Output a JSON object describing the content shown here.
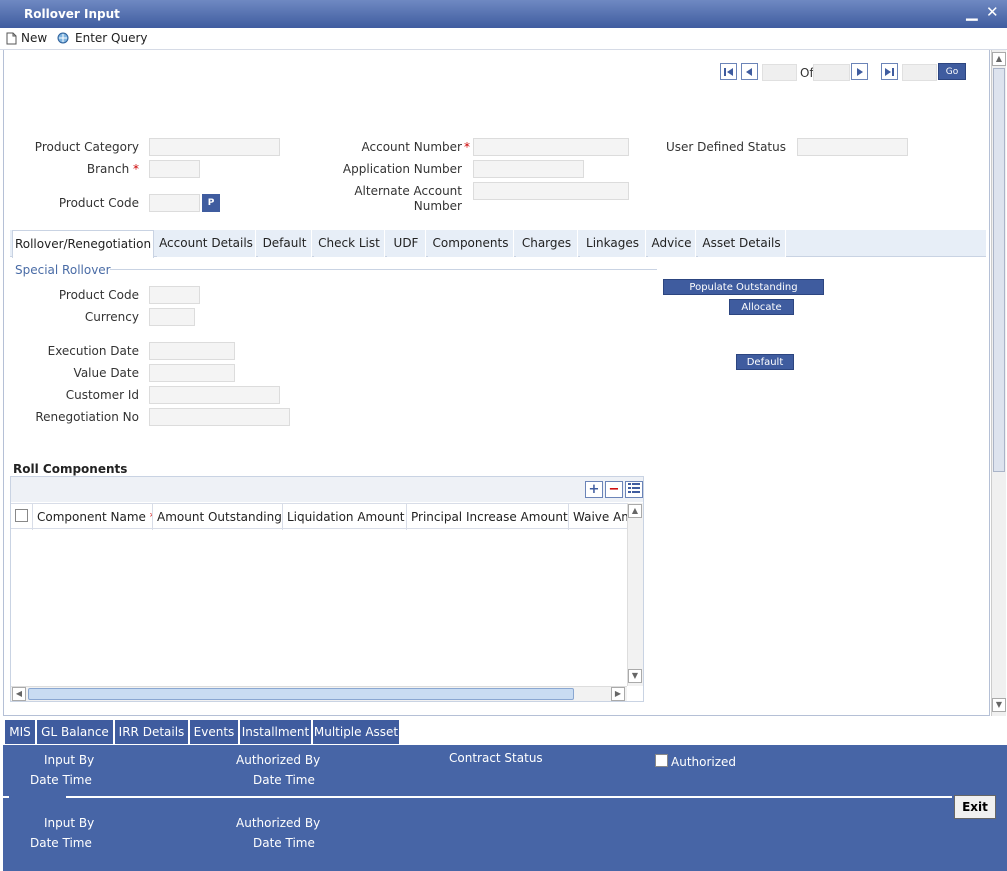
{
  "window": {
    "title": "Rollover Input"
  },
  "toolbar": {
    "new_label": "New",
    "enter_query_label": "Enter Query"
  },
  "pager": {
    "of_label": "Of",
    "go_label": "Go"
  },
  "header_fields": {
    "product_category": "Product Category",
    "branch": "Branch",
    "product_code": "Product Code",
    "p_button": "P",
    "account_number": "Account Number",
    "application_number": "Application Number",
    "alternate_account_line1": "Alternate Account",
    "alternate_account_line2": "Number",
    "user_defined_status": "User Defined Status",
    "required_mark": "*"
  },
  "tabs": [
    {
      "label": "Rollover/Renegotiation"
    },
    {
      "label": "Account Details"
    },
    {
      "label": "Default"
    },
    {
      "label": "Check List"
    },
    {
      "label": "UDF"
    },
    {
      "label": "Components"
    },
    {
      "label": "Charges"
    },
    {
      "label": "Linkages"
    },
    {
      "label": "Advice"
    },
    {
      "label": "Asset Details"
    }
  ],
  "special_rollover": {
    "title": "Special Rollover",
    "product_code": "Product Code",
    "currency": "Currency",
    "execution_date": "Execution Date",
    "value_date": "Value Date",
    "customer_id": "Customer Id",
    "renegotiation_no": "Renegotiation No",
    "populate_outstanding": "Populate Outstanding",
    "allocate": "Allocate",
    "default": "Default"
  },
  "roll_components": {
    "title": "Roll Components",
    "columns": [
      "Component Name",
      "Amount Outstanding",
      "Liquidation Amount",
      "Principal Increase Amount",
      "Waive Am"
    ]
  },
  "bottom_tabs": [
    "MIS",
    "GL Balance",
    "IRR Details",
    "Events",
    "Installment",
    "Multiple Asset"
  ],
  "footer": {
    "input_by": "Input By",
    "date_time": "Date Time",
    "authorized_by": "Authorized By",
    "contract_status": "Contract Status",
    "authorized": "Authorized",
    "exit": "Exit"
  }
}
